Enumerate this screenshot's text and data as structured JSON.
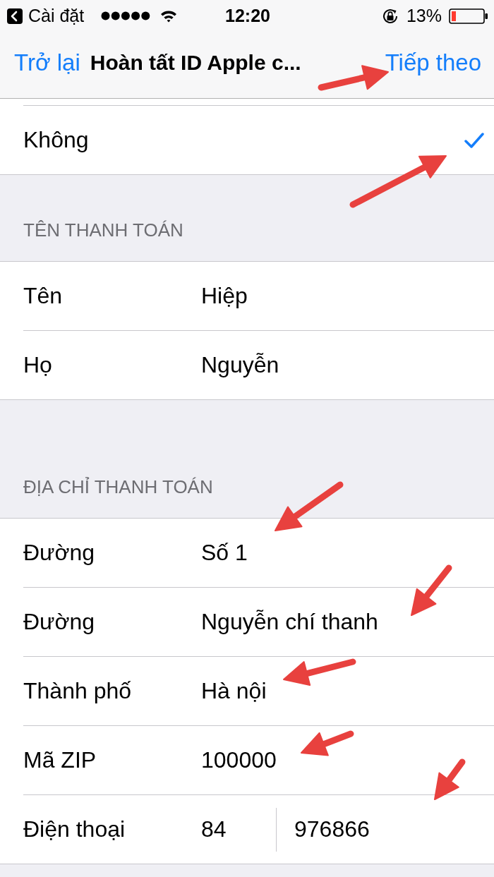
{
  "status_bar": {
    "back_app": "Cài đặt",
    "time": "12:20",
    "battery": "13%"
  },
  "nav_bar": {
    "back": "Trở lại",
    "title": "Hoàn tất ID Apple c...",
    "next": "Tiếp theo"
  },
  "sections": [
    {
      "rows": [
        {
          "kind": "option",
          "label": "Không",
          "checked": true
        }
      ]
    },
    {
      "header": "TÊN THANH TOÁN",
      "rows": [
        {
          "kind": "field",
          "label": "Tên",
          "value": "Hiệp"
        },
        {
          "kind": "field",
          "label": "Họ",
          "value": "Nguyễn"
        }
      ]
    },
    {
      "header": "ĐỊA CHỈ THANH TOÁN",
      "rows": [
        {
          "kind": "field",
          "label": "Đường",
          "value": "Số 1"
        },
        {
          "kind": "field",
          "label": "Đường",
          "value": "Nguyễn chí thanh"
        },
        {
          "kind": "field",
          "label": "Thành phố",
          "value": "Hà nội"
        },
        {
          "kind": "field",
          "label": "Mã ZIP",
          "value": "100000"
        },
        {
          "kind": "phone",
          "label": "Điện thoại",
          "code": "84",
          "number": "976866"
        }
      ]
    }
  ]
}
